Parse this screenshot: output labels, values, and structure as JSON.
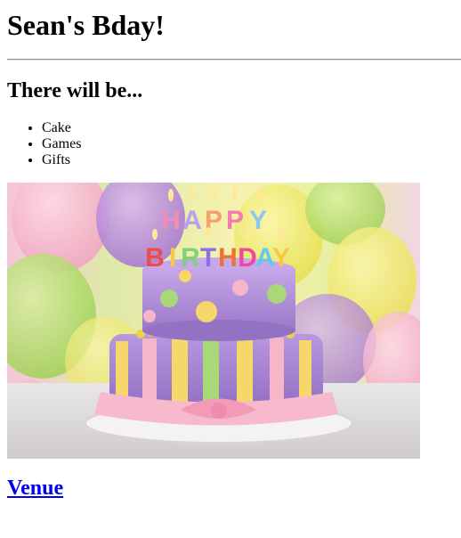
{
  "page": {
    "title": "Sean's Bday!",
    "subtitle": "There will be...",
    "items": [
      "Cake",
      "Games",
      "Gifts"
    ],
    "image": {
      "alt": "Birthday cake",
      "candle_letters": [
        "H",
        "A",
        "P",
        "P",
        "Y",
        "B",
        "I",
        "R",
        "T",
        "H",
        "D",
        "A",
        "Y"
      ]
    },
    "venue_link": "Venue"
  },
  "colors": {
    "link": "#0000ee",
    "text": "#000000",
    "background": "#ffffff"
  }
}
